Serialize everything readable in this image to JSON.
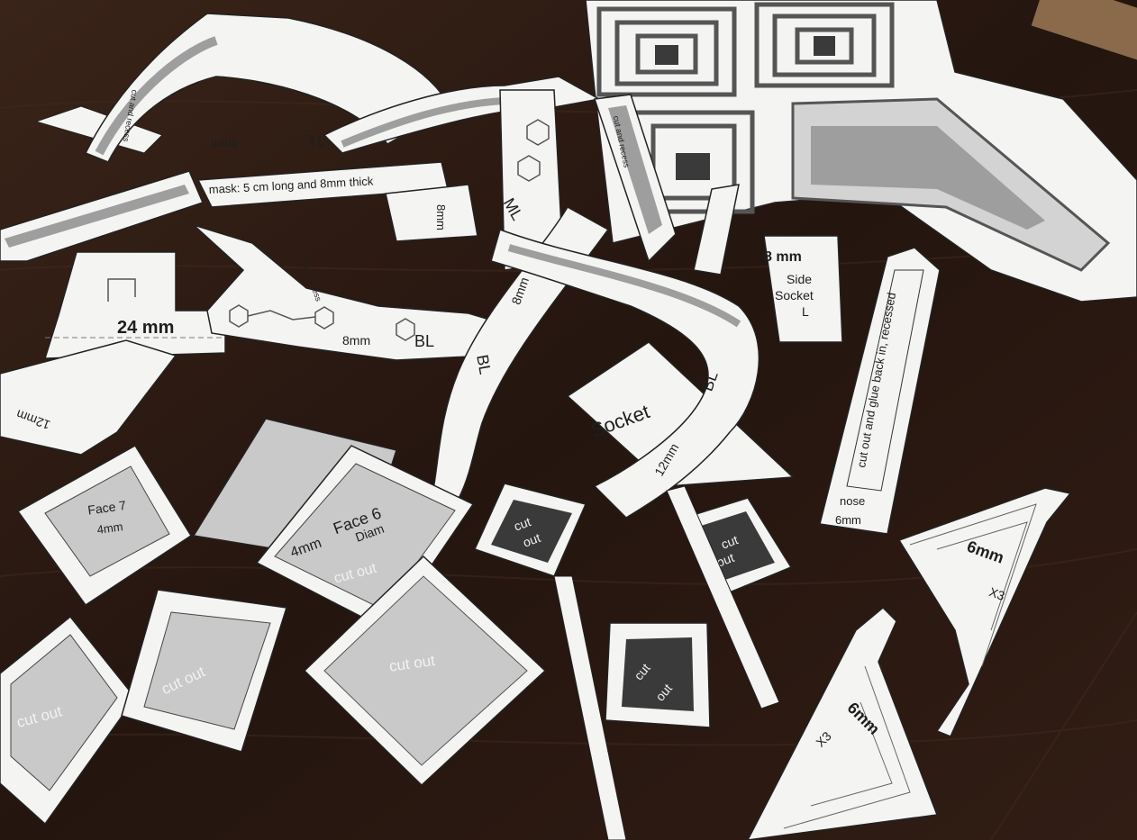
{
  "scene": {
    "colors": {
      "table": "#2a1a14",
      "paper": "#f4f4f2",
      "ink": "#1e1e1e",
      "shade": "#c9c9c9",
      "dark_square": "#3a3a3a"
    }
  },
  "labels": {
    "tl_label": "TL",
    "tl_mm": "8mm",
    "cut_recess_1": "cut and recess",
    "cut_recess_2": "cut and recess",
    "cut_recess_3": "and recess",
    "mask_note": "mask: 5 cm long and 8mm thick",
    "mm8_tab": "8mm",
    "ml_label": "ML",
    "mm24": "24 mm",
    "mm12_left": "12mm",
    "bl_mm": "8mm",
    "bl_label": "BL",
    "bl2_mm": "8mm",
    "bl2_label": "BL",
    "socket_label": "Socket",
    "bl3_label": "BL",
    "bl3_mm": "12mm",
    "side_mm": "8 mm",
    "side_title": "Side",
    "side_socket": "Socket",
    "side_l": "L",
    "nose_note": "cut out and glue back in, recessed",
    "nose_label": "nose",
    "nose_mm": "6mm",
    "face7": "Face 7",
    "face7_mm": "4mm",
    "face6": "Face 6",
    "face6_mm": "4mm",
    "face6_sub": "Diam",
    "cutout_a": "cut out",
    "cutout_b": "cut out",
    "cutout_c": "cut out",
    "cutout_d": "cut out",
    "cutout_dark1_a": "cut",
    "cutout_dark1_b": "out",
    "cutout_dark2_a": "cut",
    "cutout_dark2_b": "out",
    "cutout_dark3_a": "cut",
    "cutout_dark3_b": "out",
    "tri1_mm": "6mm",
    "tri1_x": "X3",
    "tri2_mm": "6mm",
    "tri2_x": "X3"
  }
}
